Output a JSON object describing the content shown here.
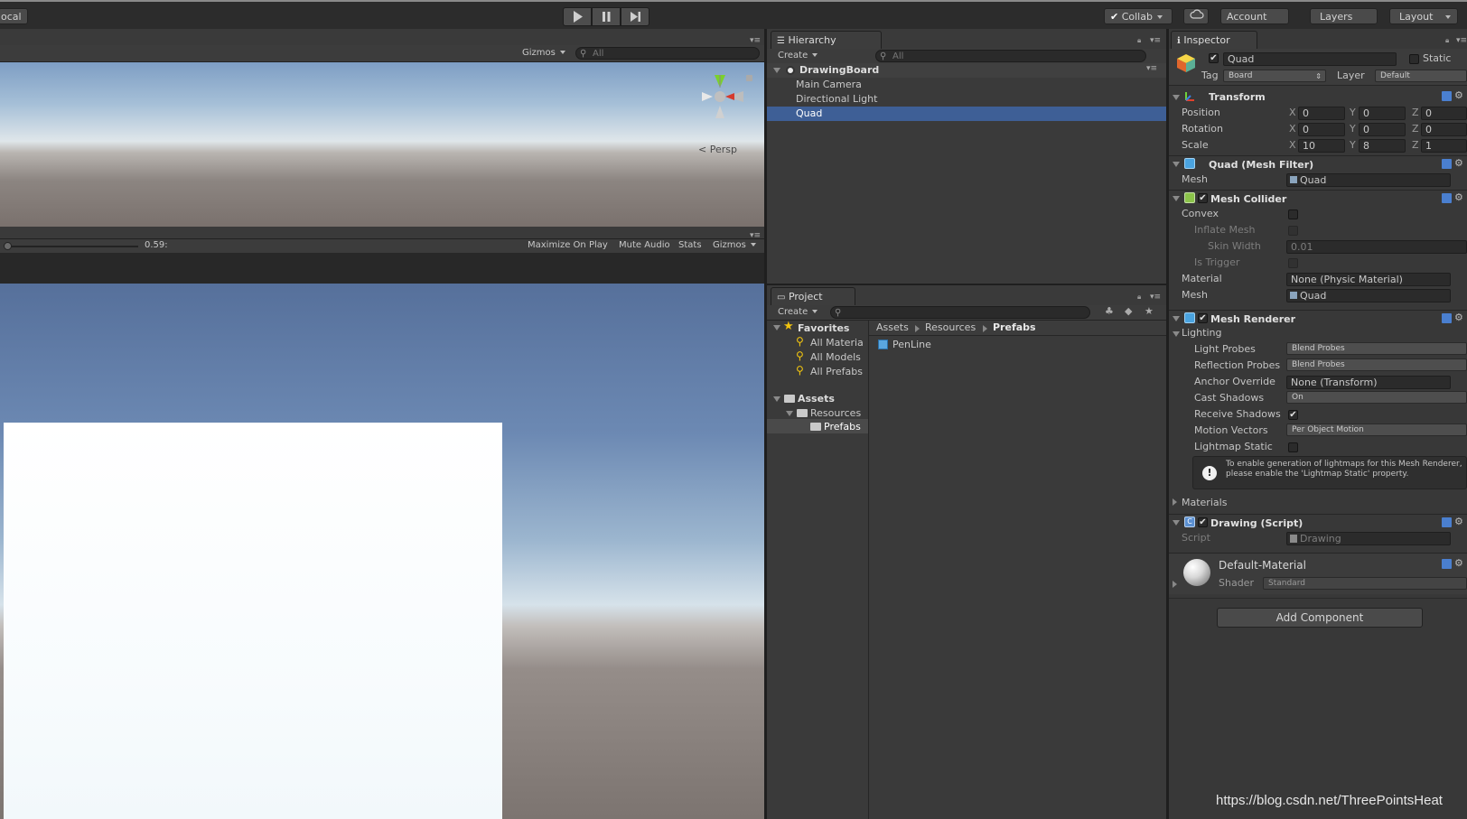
{
  "toolbar": {
    "pivot_label": "ocal",
    "play_icon": "play-icon",
    "pause_icon": "pause-icon",
    "step_icon": "step-icon",
    "collab_label": "Collab",
    "account_label": "Account",
    "layers_label": "Layers",
    "layout_label": "Layout"
  },
  "scene": {
    "gizmos_label": "Gizmos",
    "search_placeholder": "All",
    "persp_label": "Persp"
  },
  "game": {
    "time_label": "0.59:",
    "buttons": [
      "Maximize On Play",
      "Mute Audio",
      "Stats",
      "Gizmos"
    ]
  },
  "hierarchy": {
    "tab_label": "Hierarchy",
    "create_label": "Create",
    "search_placeholder": "All",
    "scene_name": "DrawingBoard",
    "items": [
      "Main Camera",
      "Directional Light",
      "Quad"
    ],
    "selected": "Quad"
  },
  "project": {
    "tab_label": "Project",
    "create_label": "Create",
    "favorites_label": "Favorites",
    "favorites": [
      "All Materia",
      "All Models",
      "All Prefabs"
    ],
    "assets_label": "Assets",
    "resources_label": "Resources",
    "prefabs_label": "Prefabs",
    "breadcrumb": [
      "Assets",
      "Resources",
      "Prefabs"
    ],
    "files": [
      "PenLine"
    ]
  },
  "inspector": {
    "tab_label": "Inspector",
    "object_name": "Quad",
    "static_label": "Static",
    "tag_label": "Tag",
    "tag_value": "Board",
    "layer_label": "Layer",
    "layer_value": "Default",
    "transform": {
      "title": "Transform",
      "position_label": "Position",
      "rotation_label": "Rotation",
      "scale_label": "Scale",
      "position": {
        "x": "0",
        "y": "0",
        "z": "0"
      },
      "rotation": {
        "x": "0",
        "y": "0",
        "z": "0"
      },
      "scale": {
        "x": "10",
        "y": "8",
        "z": "1"
      }
    },
    "mesh_filter": {
      "title": "Quad (Mesh Filter)",
      "mesh_label": "Mesh",
      "mesh_value": "Quad"
    },
    "mesh_collider": {
      "title": "Mesh Collider",
      "convex_label": "Convex",
      "inflate_label": "Inflate Mesh",
      "skin_label": "Skin Width",
      "skin_value": "0.01",
      "trigger_label": "Is Trigger",
      "material_label": "Material",
      "material_value": "None (Physic Material)",
      "mesh_label": "Mesh",
      "mesh_value": "Quad"
    },
    "mesh_renderer": {
      "title": "Mesh Renderer",
      "lighting_label": "Lighting",
      "light_probes_label": "Light Probes",
      "light_probes_value": "Blend Probes",
      "reflection_label": "Reflection Probes",
      "reflection_value": "Blend Probes",
      "anchor_label": "Anchor Override",
      "anchor_value": "None (Transform)",
      "cast_label": "Cast Shadows",
      "cast_value": "On",
      "receive_label": "Receive Shadows",
      "motion_label": "Motion Vectors",
      "motion_value": "Per Object Motion",
      "lightmap_label": "Lightmap Static",
      "info_text": "To enable generation of lightmaps for this Mesh Renderer, please enable the 'Lightmap Static' property.",
      "materials_label": "Materials"
    },
    "script": {
      "title": "Drawing (Script)",
      "script_label": "Script",
      "script_value": "Drawing"
    },
    "material": {
      "name": "Default-Material",
      "shader_label": "Shader",
      "shader_value": "Standard"
    },
    "add_component_label": "Add Component"
  },
  "watermark": "https://blog.csdn.net/ThreePointsHeat",
  "colors": {
    "selection": "#3e5f96",
    "accent": "#2f65c6"
  }
}
